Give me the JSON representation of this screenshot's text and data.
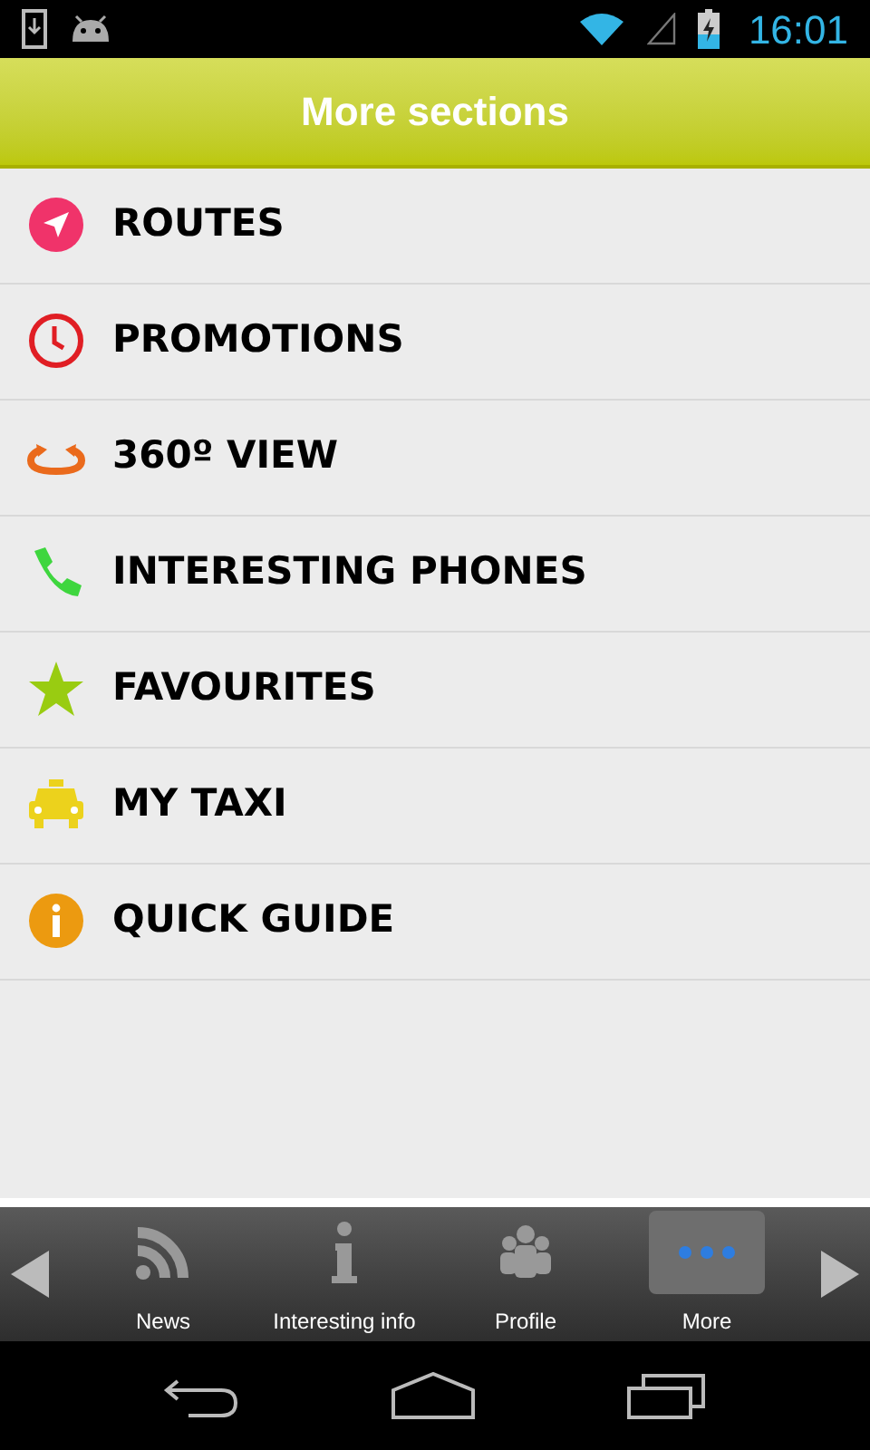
{
  "status_bar": {
    "time": "16:01"
  },
  "header": {
    "title": "More sections"
  },
  "menu": [
    {
      "kind": "routes",
      "label": "ROUTES",
      "color": "#f0336a"
    },
    {
      "kind": "promotions",
      "label": "PROMOTIONS",
      "color": "#e01e24"
    },
    {
      "kind": "view",
      "label": "360º VIEW",
      "color": "#ea6a1c"
    },
    {
      "kind": "phones",
      "label": "INTERESTING PHONES",
      "color": "#3ed63e"
    },
    {
      "kind": "favourites",
      "label": "FAVOURITES",
      "color": "#99cc11"
    },
    {
      "kind": "taxi",
      "label": "MY TAXI",
      "color": "#ecd21c"
    },
    {
      "kind": "guide",
      "label": "QUICK GUIDE",
      "color": "#ec9a10"
    }
  ],
  "tabs": [
    {
      "kind": "news",
      "label": "News",
      "selected": false
    },
    {
      "kind": "info",
      "label": "Interesting info",
      "selected": false
    },
    {
      "kind": "profile",
      "label": "Profile",
      "selected": false
    },
    {
      "kind": "more",
      "label": "More",
      "selected": true
    }
  ]
}
